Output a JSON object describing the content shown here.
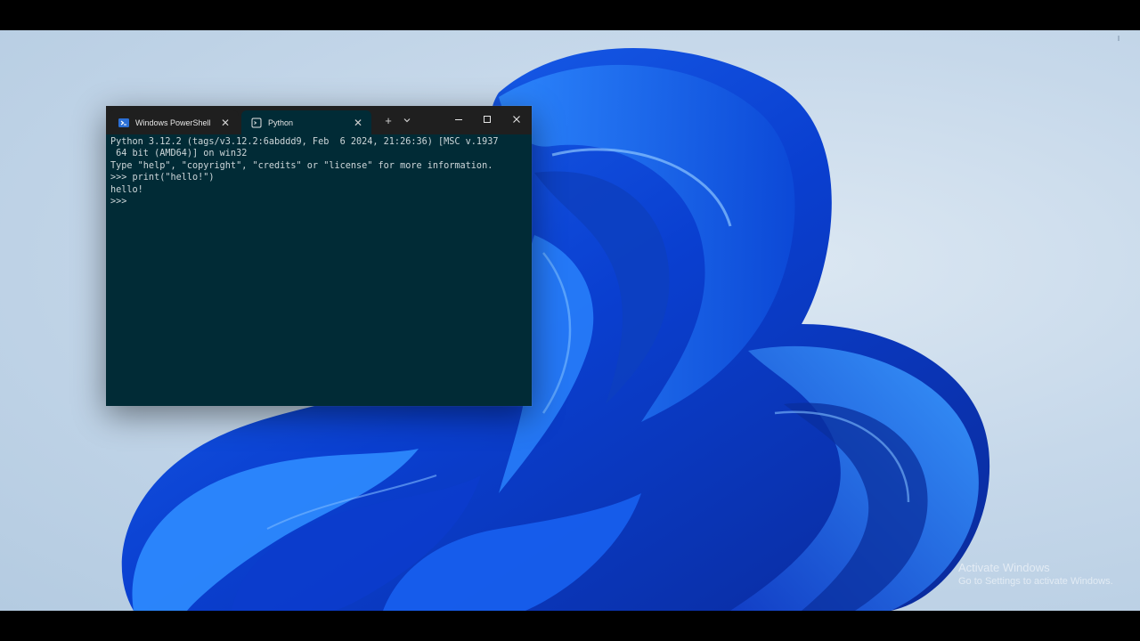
{
  "desktop": {
    "watermark": {
      "title": "Activate Windows",
      "subtitle": "Go to Settings to activate Windows."
    }
  },
  "terminal": {
    "tabs": [
      {
        "label": "Windows PowerShell",
        "icon": "powershell-icon",
        "active": false
      },
      {
        "label": "Python",
        "icon": "python-console-icon",
        "active": true
      }
    ],
    "new_tab_glyph": "+",
    "close_glyph": "✕",
    "controls": [
      "minimize-icon",
      "maximize-icon",
      "close-icon"
    ],
    "lines": [
      "Python 3.12.2 (tags/v3.12.2:6abddd9, Feb  6 2024, 21:26:36) [MSC v.1937",
      " 64 bit (AMD64)] on win32",
      "Type \"help\", \"copyright\", \"credits\" or \"license\" for more information.",
      ">>> print(\"hello!\")",
      "hello!",
      ">>> "
    ],
    "colors": {
      "background": "#012b36",
      "titlebar": "#1f1f1f",
      "text": "#cdd6d9"
    }
  }
}
